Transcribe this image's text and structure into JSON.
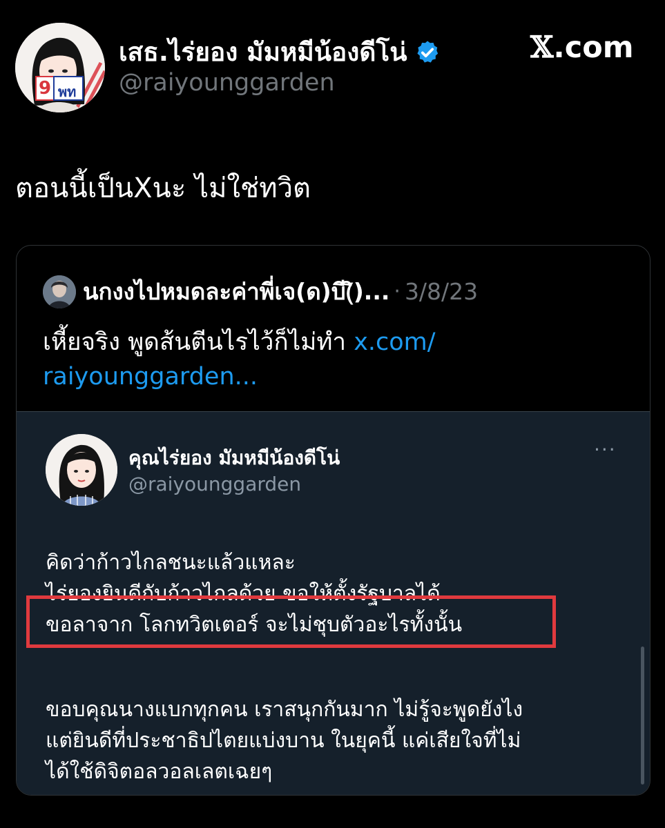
{
  "author": {
    "display_name": "เสธ.ไร่ยอง มัมหมีน้องดีโน่",
    "handle": "@raiyounggarden",
    "avatar_badge_number": "9",
    "avatar_badge_text": "พท"
  },
  "brand": {
    "x": "𝕏",
    "rest": ".com"
  },
  "tweet": {
    "text": "ตอนนี้เป็นXนะ ไม่ใช่ทวิต"
  },
  "quote": {
    "author_name": "นกงงไปหมดละค่าพี่เจ(ด)บี(ิ)...",
    "separator": "·",
    "date": "3/8/23",
    "text": "เหี้ยจริง พูดส้นตีนไรไว้ก็ไม่ทำ ",
    "link_line1": "x.com/",
    "link_line2": "raiyounggarden..."
  },
  "screenshot": {
    "name": "คุณไร่ยอง มัมหมีน้องดีโน่",
    "handle": "@raiyounggarden",
    "more": "···",
    "lines": [
      "คิดว่าก้าวไกลชนะแล้วแหละ",
      "ไร่ยองยินดีกับก้าวไกลด้วย ขอให้ตั้งรัฐบาลได้",
      "ขอลาจาก โลกทวิตเตอร์ จะไม่ชุบตัวอะไรทั้งนั้น",
      "ขอบคุณนางแบกทุกคน เราสนุกกันมาก ไม่รู้จะพูดยังไง",
      "แต่ยินดีที่ประชาธิปไตยแบ่งบาน ในยุคนี้ แค่เสียใจที่ไม่",
      "ได้ใช้ดิจิตอลวอลเลตเฉยๆ"
    ]
  },
  "colors": {
    "link": "#1d9bf0",
    "verified": "#1d9bf0",
    "highlight": "#e03a3e",
    "card_bg": "#15202b"
  }
}
